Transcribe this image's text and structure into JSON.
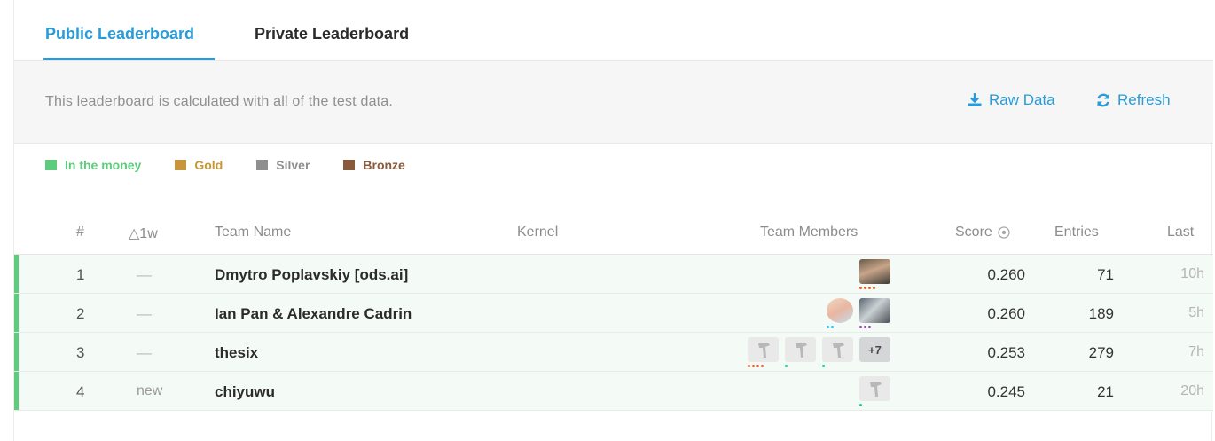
{
  "tabs": {
    "public": "Public Leaderboard",
    "private": "Private Leaderboard"
  },
  "info": {
    "text": "This leaderboard is calculated with all of the test data.",
    "raw_data": "Raw Data",
    "refresh": "Refresh"
  },
  "legend": [
    {
      "label": "In the money",
      "color": "#5ecb7d"
    },
    {
      "label": "Gold",
      "color": "#c8963a"
    },
    {
      "label": "Silver",
      "color": "#8f8f8f"
    },
    {
      "label": "Bronze",
      "color": "#8a5a3c"
    }
  ],
  "columns": {
    "rank": "#",
    "change": "△1w",
    "team": "Team Name",
    "kernel": "Kernel",
    "members": "Team Members",
    "score": "Score",
    "entries": "Entries",
    "last": "Last"
  },
  "rows": [
    {
      "rank": "1",
      "change": "—",
      "team": "Dmytro Poplavskiy [ods.ai]",
      "score": "0.260",
      "entries": "71",
      "last": "10h"
    },
    {
      "rank": "2",
      "change": "—",
      "team": "Ian Pan & Alexandre Cadrin",
      "score": "0.260",
      "entries": "189",
      "last": "5h"
    },
    {
      "rank": "3",
      "change": "—",
      "team": "thesix",
      "score": "0.253",
      "entries": "279",
      "last": "7h",
      "more_members": "+7"
    },
    {
      "rank": "4",
      "change": "new",
      "team": "chiyuwu",
      "score": "0.245",
      "entries": "21",
      "last": "20h"
    }
  ],
  "colors": {
    "accent": "#2a9bd6",
    "in_the_money": "#5ecb7d",
    "row_bg": "#f4faf5"
  }
}
